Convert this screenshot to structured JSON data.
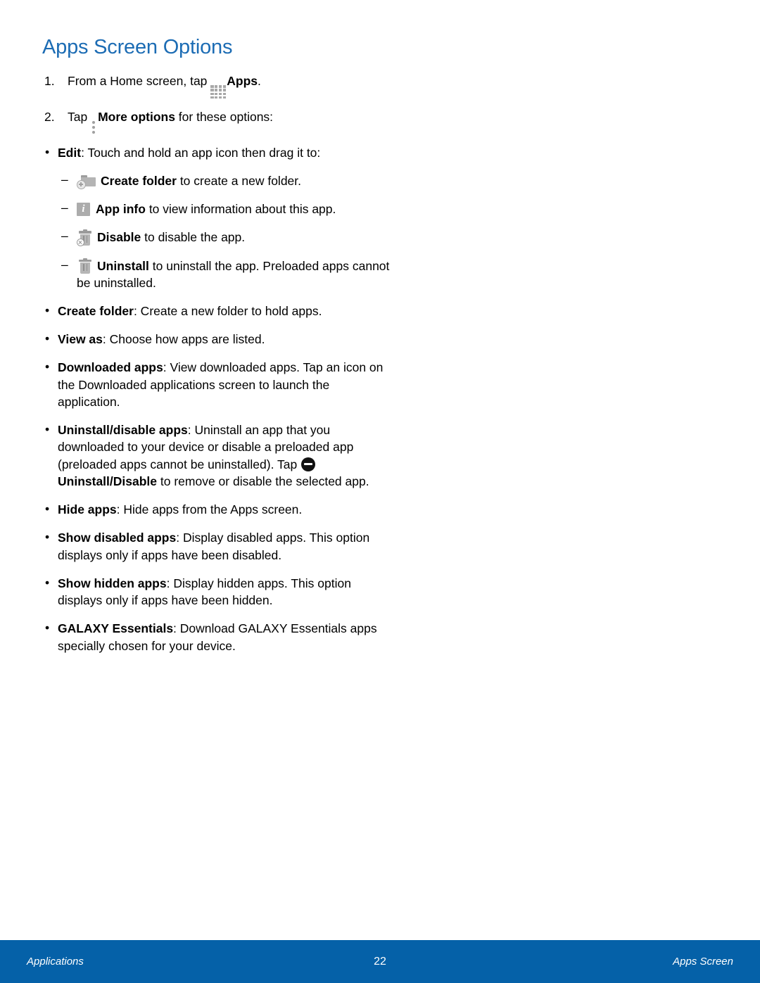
{
  "document": {
    "title": "Apps Screen Options",
    "title_color": "#1c6cb4"
  },
  "steps": [
    {
      "number": "1.",
      "pre": "From a Home screen, tap ",
      "icon": "apps-grid-icon",
      "bold": "Apps",
      "post": "."
    },
    {
      "number": "2.",
      "pre": "Tap ",
      "icon": "more-options-icon",
      "bold": "More options",
      "post": " for these options:"
    }
  ],
  "bullets": [
    {
      "marker": "•",
      "bold": "Edit",
      "text": ": Touch and hold an app icon then drag it to:",
      "subbullets": [
        {
          "marker": "–",
          "icon": "create-folder-icon",
          "bold": "Create folder",
          "text": " to create a new folder."
        },
        {
          "marker": "–",
          "icon": "app-info-icon",
          "bold": "App info",
          "text": " to view information about this app."
        },
        {
          "marker": "–",
          "icon": "disable-trash-icon",
          "bold": "Disable",
          "text": " to disable the app."
        },
        {
          "marker": "–",
          "icon": "uninstall-trash-icon",
          "bold": "Uninstall",
          "text": " to uninstall the app. Preloaded apps cannot be uninstalled."
        }
      ]
    },
    {
      "marker": "•",
      "bold": "Create folder",
      "text": ": Create a new folder to hold apps."
    },
    {
      "marker": "•",
      "bold": "View as",
      "text": ": Choose how apps are listed."
    },
    {
      "marker": "•",
      "bold": "Downloaded apps",
      "text": ": View downloaded apps. Tap an icon on the Downloaded applications screen to launch the application."
    },
    {
      "marker": "•",
      "bold": "Uninstall/disable apps",
      "text": ": Uninstall an app that you downloaded to your device or disable a preloaded app (preloaded apps cannot be uninstalled). Tap ",
      "inline_icon": "minus-circle-icon",
      "bold2": "Uninstall/Disable",
      "text2": " to remove or disable the selected app."
    },
    {
      "marker": "•",
      "bold": "Hide apps",
      "text": ": Hide apps from the Apps screen."
    },
    {
      "marker": "•",
      "bold": "Show disabled apps",
      "text": ": Display disabled apps. This option displays only if apps have been disabled."
    },
    {
      "marker": "•",
      "bold": "Show hidden apps",
      "text": ": Display hidden apps. This option displays only if apps have been hidden."
    },
    {
      "marker": "•",
      "bold": "GALAXY Essentials",
      "text": ": Download GALAXY Essentials apps specially chosen for your device."
    }
  ],
  "footer": {
    "left": "Applications",
    "page_number": "22",
    "right": "Apps Screen",
    "background_color": "#0561a8"
  }
}
